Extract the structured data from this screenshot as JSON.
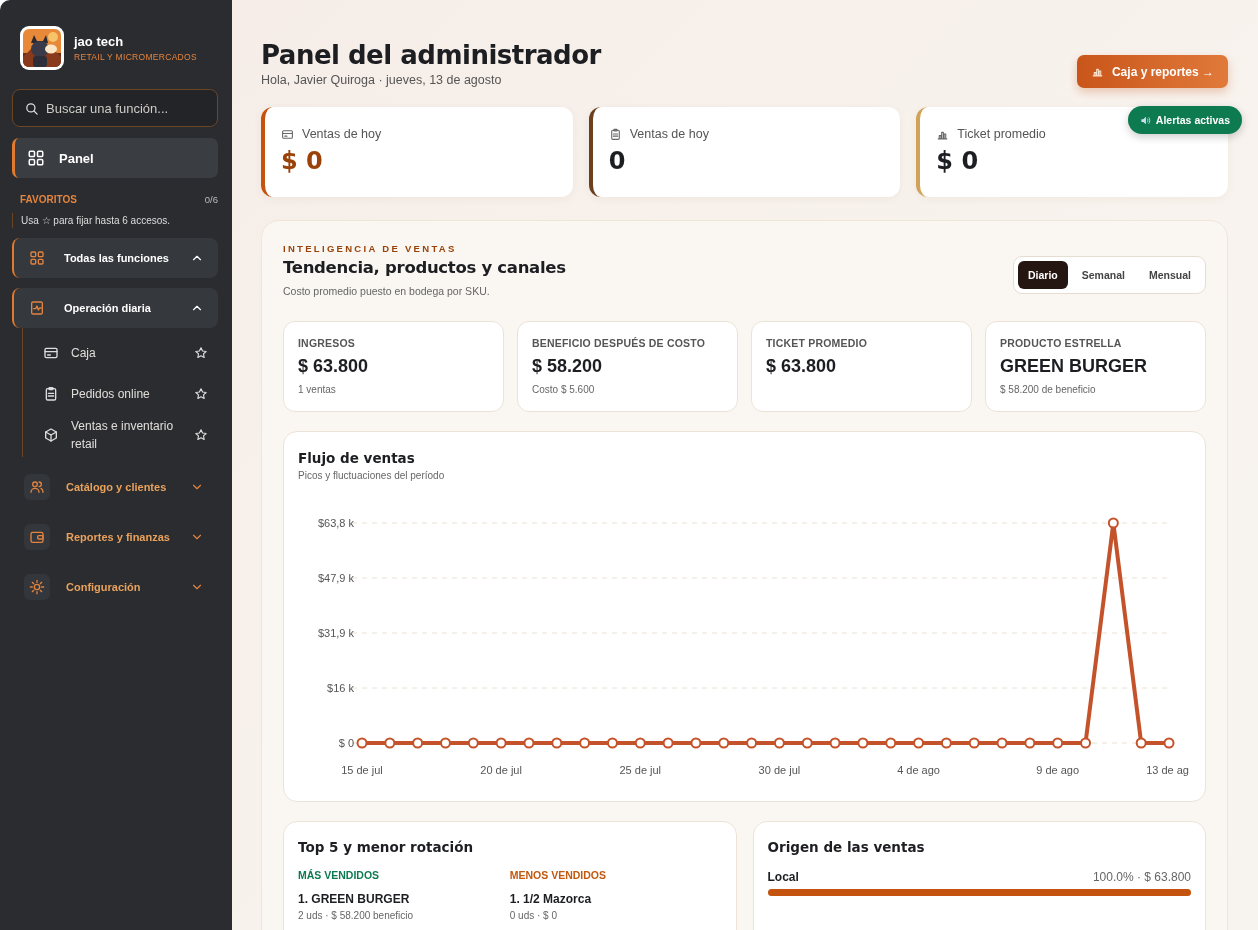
{
  "sidebar": {
    "brand": {
      "name": "jao tech",
      "tagline": "RETAIL Y MICROMERCADOS"
    },
    "search": {
      "placeholder": "Buscar una función..."
    },
    "home": {
      "label": "Panel",
      "selected": true
    },
    "favorites": {
      "title": "FAVORITOS",
      "count": "0/6",
      "hint": "Usa ☆ para fijar hasta 6 accesos."
    },
    "groups": [
      {
        "label": "Todas las funciones",
        "expanded": true,
        "highlighted": true
      },
      {
        "label": "Operación diaria",
        "expanded": true,
        "highlighted": true,
        "children": [
          {
            "label": "Caja",
            "favorite": false
          },
          {
            "label": "Pedidos online",
            "favorite": false
          },
          {
            "label": "Ventas e inventario retail",
            "favorite": false
          }
        ]
      },
      {
        "label": "Catálogo y clientes",
        "expanded": false,
        "highlighted": false
      },
      {
        "label": "Reportes y finanzas",
        "expanded": false,
        "highlighted": false
      },
      {
        "label": "Configuración",
        "expanded": false,
        "highlighted": false
      }
    ]
  },
  "header": {
    "title": "Panel del administrador",
    "greeting": "Hola, Javier Quiroga · jueves, 13 de agosto",
    "action": "Caja y reportes →",
    "alert": "Alertas activas"
  },
  "stats": [
    {
      "label": "Ventas de hoy",
      "value": "$ 0",
      "color": "#c4530f",
      "emphasis": true
    },
    {
      "label": "Ventas de hoy",
      "value": "0",
      "color": "#6e3f1c",
      "emphasis": false
    },
    {
      "label": "Ticket promedio",
      "value": "$ 0",
      "color": "#cfa458",
      "emphasis": false
    }
  ],
  "intelligence": {
    "eyebrow": "INTELIGENCIA DE VENTAS",
    "title": "Tendencia, productos y canales",
    "subtitle": "Costo promedio puesto en bodega por SKU.",
    "periods": [
      {
        "label": "Diario",
        "selected": true
      },
      {
        "label": "Semanal",
        "selected": false
      },
      {
        "label": "Mensual",
        "selected": false
      }
    ],
    "metrics": [
      {
        "label": "INGRESOS",
        "value": "$ 63.800",
        "note": "1 ventas"
      },
      {
        "label": "BENEFICIO DESPUÉS DE COSTO",
        "value": "$ 58.200",
        "note": "Costo $ 5.600"
      },
      {
        "label": "TICKET PROMEDIO",
        "value": "$ 63.800"
      },
      {
        "label": "PRODUCTO ESTRELLA",
        "value": "GREEN BURGER",
        "note": "$ 58.200 de beneficio"
      }
    ],
    "flow": {
      "title": "Flujo de ventas",
      "subtitle": "Picos y fluctuaciones del período",
      "chart_data": {
        "type": "line",
        "categories": [
          "15 de jul",
          null,
          null,
          null,
          null,
          "20 de jul",
          null,
          null,
          null,
          null,
          "25 de jul",
          null,
          null,
          null,
          null,
          "30 de jul",
          null,
          null,
          null,
          null,
          "4 de ago",
          null,
          null,
          null,
          null,
          "9 de ago",
          null,
          null,
          null,
          "13 de ag"
        ],
        "grid": true,
        "series": [
          {
            "color": "#c4532b",
            "marker": true,
            "values": [
              0,
              0,
              0,
              0,
              0,
              0,
              0,
              0,
              0,
              0,
              0,
              0,
              0,
              0,
              0,
              0,
              0,
              0,
              0,
              0,
              0,
              0,
              0,
              0,
              0,
              0,
              0,
              63800,
              0,
              0
            ]
          }
        ],
        "ylim": [
          0,
          63800
        ],
        "yticks": [
          {
            "value": 0,
            "label": "$ 0"
          },
          {
            "value": 15950,
            "label": "$16 k"
          },
          {
            "value": 31900,
            "label": "$31,9 k"
          },
          {
            "value": 47850,
            "label": "$47,9 k"
          },
          {
            "value": 63800,
            "label": "$63,8 k"
          }
        ]
      }
    },
    "top": {
      "title": "Top 5 y menor rotación",
      "lists": [
        {
          "heading": "MÁS VENDIDOS",
          "color": "#0e7a52",
          "items": [
            {
              "name": "1. GREEN BURGER",
              "detail": "2 uds · $ 58.200 beneficio"
            }
          ]
        },
        {
          "heading": "MENOS VENDIDOS",
          "color": "#c4580f",
          "items": [
            {
              "name": "1. 1/2 Mazorca",
              "detail": "0 uds · $ 0"
            }
          ]
        }
      ]
    },
    "origin": {
      "title": "Origen de las ventas",
      "channels": [
        {
          "name": "Local",
          "reading": "100.0% · $ 63.800",
          "level": 1
        }
      ]
    }
  }
}
